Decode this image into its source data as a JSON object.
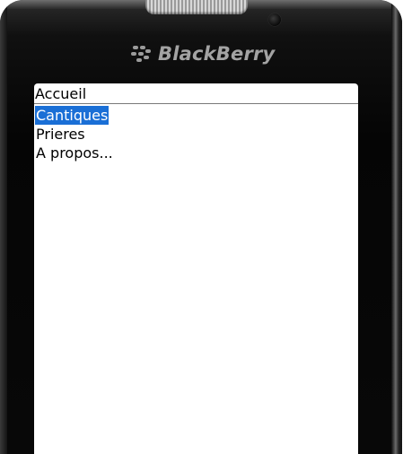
{
  "device": {
    "brand_text": "BlackBerry",
    "brand_icon": "blackberry-logo-icon"
  },
  "app": {
    "title": "Accueil",
    "menu": {
      "items": [
        {
          "label": "Cantiques",
          "selected": true
        },
        {
          "label": "Prieres",
          "selected": false
        },
        {
          "label": "A propos...",
          "selected": false
        }
      ]
    }
  },
  "colors": {
    "selection": "#1a6fd6",
    "screen_bg": "#ffffff",
    "device_body": "#050505"
  }
}
